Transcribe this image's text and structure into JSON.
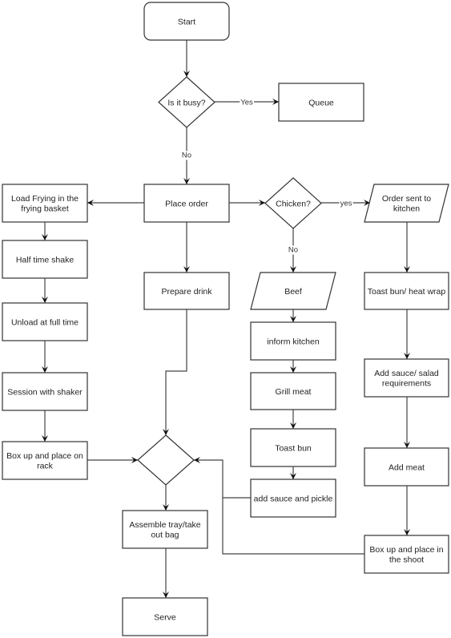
{
  "diagram": {
    "type": "flowchart",
    "nodes": [
      {
        "id": "start",
        "shape": "rounded-rect",
        "lines": [
          "Start"
        ]
      },
      {
        "id": "busy",
        "shape": "diamond",
        "lines": [
          "Is it busy?"
        ]
      },
      {
        "id": "queue",
        "shape": "rect",
        "lines": [
          "Queue"
        ]
      },
      {
        "id": "place_order",
        "shape": "rect",
        "lines": [
          "Place order"
        ]
      },
      {
        "id": "load_frying",
        "shape": "rect",
        "lines": [
          "Load Frying in the",
          "frying basket"
        ]
      },
      {
        "id": "chicken",
        "shape": "diamond",
        "lines": [
          "Chicken?"
        ]
      },
      {
        "id": "order_sent",
        "shape": "parallelogram",
        "lines": [
          "Order sent to",
          "kitchen"
        ]
      },
      {
        "id": "half_time",
        "shape": "rect",
        "lines": [
          "Half time shake"
        ]
      },
      {
        "id": "prepare_drink",
        "shape": "rect",
        "lines": [
          "Prepare drink"
        ]
      },
      {
        "id": "beef",
        "shape": "parallelogram",
        "lines": [
          "Beef"
        ]
      },
      {
        "id": "toast_wrap",
        "shape": "rect",
        "lines": [
          "Toast bun/ heat wrap"
        ]
      },
      {
        "id": "unload",
        "shape": "rect",
        "lines": [
          "Unload at full time"
        ]
      },
      {
        "id": "inform_kitchen",
        "shape": "rect",
        "lines": [
          "inform kitchen"
        ]
      },
      {
        "id": "session",
        "shape": "rect",
        "lines": [
          "Session with shaker"
        ]
      },
      {
        "id": "grill",
        "shape": "rect",
        "lines": [
          "Grill meat"
        ]
      },
      {
        "id": "add_sauce_salad",
        "shape": "rect",
        "lines": [
          "Add sauce/ salad",
          "requirements"
        ]
      },
      {
        "id": "box_rack",
        "shape": "rect",
        "lines": [
          "Box up and place on",
          "rack"
        ]
      },
      {
        "id": "merge",
        "shape": "diamond",
        "lines": []
      },
      {
        "id": "toast_bun",
        "shape": "rect",
        "lines": [
          "Toast bun"
        ]
      },
      {
        "id": "add_meat",
        "shape": "rect",
        "lines": [
          "Add meat"
        ]
      },
      {
        "id": "sauce_pickle",
        "shape": "rect",
        "lines": [
          "add sauce and pickle"
        ]
      },
      {
        "id": "assemble",
        "shape": "rect",
        "lines": [
          "Assemble tray/take",
          "out bag"
        ]
      },
      {
        "id": "box_shoot",
        "shape": "rect",
        "lines": [
          "Box up and place in",
          "the shoot"
        ]
      },
      {
        "id": "serve",
        "shape": "rect",
        "lines": [
          "Serve"
        ]
      }
    ],
    "edges": [
      {
        "from": "start",
        "to": "busy",
        "label": ""
      },
      {
        "from": "busy",
        "to": "queue",
        "label": "Yes"
      },
      {
        "from": "busy",
        "to": "place_order",
        "label": "No"
      },
      {
        "from": "place_order",
        "to": "load_frying",
        "label": ""
      },
      {
        "from": "place_order",
        "to": "chicken",
        "label": ""
      },
      {
        "from": "place_order",
        "to": "prepare_drink",
        "label": ""
      },
      {
        "from": "chicken",
        "to": "order_sent",
        "label": "yes"
      },
      {
        "from": "chicken",
        "to": "beef",
        "label": "No"
      },
      {
        "from": "load_frying",
        "to": "half_time",
        "label": ""
      },
      {
        "from": "half_time",
        "to": "unload",
        "label": ""
      },
      {
        "from": "unload",
        "to": "session",
        "label": ""
      },
      {
        "from": "session",
        "to": "box_rack",
        "label": ""
      },
      {
        "from": "box_rack",
        "to": "merge",
        "label": ""
      },
      {
        "from": "prepare_drink",
        "to": "merge",
        "label": ""
      },
      {
        "from": "beef",
        "to": "inform_kitchen",
        "label": ""
      },
      {
        "from": "inform_kitchen",
        "to": "grill",
        "label": ""
      },
      {
        "from": "grill",
        "to": "toast_bun",
        "label": ""
      },
      {
        "from": "toast_bun",
        "to": "sauce_pickle",
        "label": ""
      },
      {
        "from": "sauce_pickle",
        "to": "merge",
        "label": ""
      },
      {
        "from": "order_sent",
        "to": "toast_wrap",
        "label": ""
      },
      {
        "from": "toast_wrap",
        "to": "add_sauce_salad",
        "label": ""
      },
      {
        "from": "add_sauce_salad",
        "to": "add_meat",
        "label": ""
      },
      {
        "from": "add_meat",
        "to": "box_shoot",
        "label": ""
      },
      {
        "from": "box_shoot",
        "to": "merge",
        "label": ""
      },
      {
        "from": "merge",
        "to": "assemble",
        "label": ""
      },
      {
        "from": "assemble",
        "to": "serve",
        "label": ""
      }
    ]
  }
}
